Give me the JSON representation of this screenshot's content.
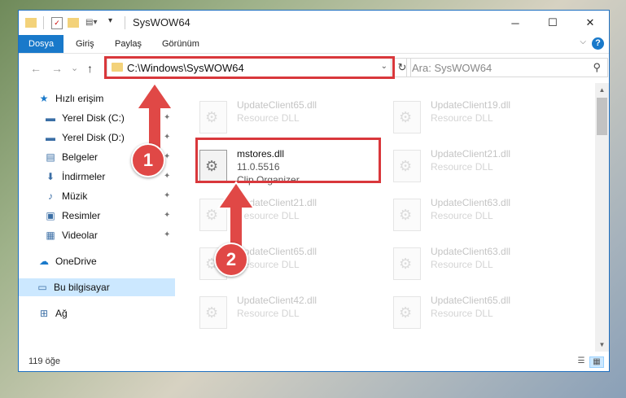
{
  "window": {
    "title": "SysWOW64",
    "minimize": "─",
    "maximize": "☐",
    "close": "✕"
  },
  "ribbon": {
    "tabs": [
      "Dosya",
      "Giriş",
      "Paylaş",
      "Görünüm"
    ],
    "help": "?",
    "collapse": "⌵"
  },
  "nav": {
    "back": "←",
    "forward": "→",
    "recent": "⌄",
    "up": "↑",
    "address": "C:\\Windows\\SysWOW64",
    "address_drop": "⌄",
    "refresh": "↻",
    "search_placeholder": "Ara: SysWOW64",
    "search_icon": "⚲"
  },
  "sidebar": {
    "items": [
      {
        "label": "Hızlı erişim",
        "icon": "★",
        "icon_name": "star-icon",
        "pinned": false
      },
      {
        "label": "Yerel Disk (C:)",
        "icon": "▬",
        "icon_name": "drive-icon",
        "pinned": true
      },
      {
        "label": "Yerel Disk (D:)",
        "icon": "▬",
        "icon_name": "drive-icon",
        "pinned": true
      },
      {
        "label": "Belgeler",
        "icon": "▤",
        "icon_name": "documents-icon",
        "pinned": true
      },
      {
        "label": "İndirmeler",
        "icon": "⬇",
        "icon_name": "downloads-icon",
        "pinned": true
      },
      {
        "label": "Müzik",
        "icon": "♪",
        "icon_name": "music-icon",
        "pinned": true
      },
      {
        "label": "Resimler",
        "icon": "▣",
        "icon_name": "pictures-icon",
        "pinned": true
      },
      {
        "label": "Videolar",
        "icon": "▦",
        "icon_name": "videos-icon",
        "pinned": true
      },
      {
        "label": "OneDrive",
        "icon": "☁",
        "icon_name": "cloud-icon",
        "pinned": false
      },
      {
        "label": "Bu bilgisayar",
        "icon": "▭",
        "icon_name": "computer-icon",
        "pinned": false
      },
      {
        "label": "Ağ",
        "icon": "⊞",
        "icon_name": "network-icon",
        "pinned": false
      }
    ],
    "pin_glyph": "✦"
  },
  "files": [
    {
      "name": "UpdateClient65.dll",
      "line2": "Resource DLL",
      "line3": ""
    },
    {
      "name": "UpdateClient19.dll",
      "line2": "Resource DLL",
      "line3": ""
    },
    {
      "name": "mstores.dll",
      "line2": "11.0.5516",
      "line3": "Clip Organizer"
    },
    {
      "name": "UpdateClient21.dll",
      "line2": "Resource DLL",
      "line3": ""
    },
    {
      "name": "UpdateClient21.dll",
      "line2": "Resource DLL",
      "line3": ""
    },
    {
      "name": "UpdateClient63.dll",
      "line2": "Resource DLL",
      "line3": ""
    },
    {
      "name": "UpdateClient65.dll",
      "line2": "Resource DLL",
      "line3": ""
    },
    {
      "name": "UpdateClient63.dll",
      "line2": "Resource DLL",
      "line3": ""
    },
    {
      "name": "UpdateClient42.dll",
      "line2": "Resource DLL",
      "line3": ""
    },
    {
      "name": "UpdateClient65.dll",
      "line2": "Resource DLL",
      "line3": ""
    }
  ],
  "status": {
    "count": "119 öğe",
    "details_view": "☰",
    "tiles_view": "▦"
  },
  "annotations": {
    "badge1": "1",
    "badge2": "2",
    "color": "#d9373b"
  }
}
